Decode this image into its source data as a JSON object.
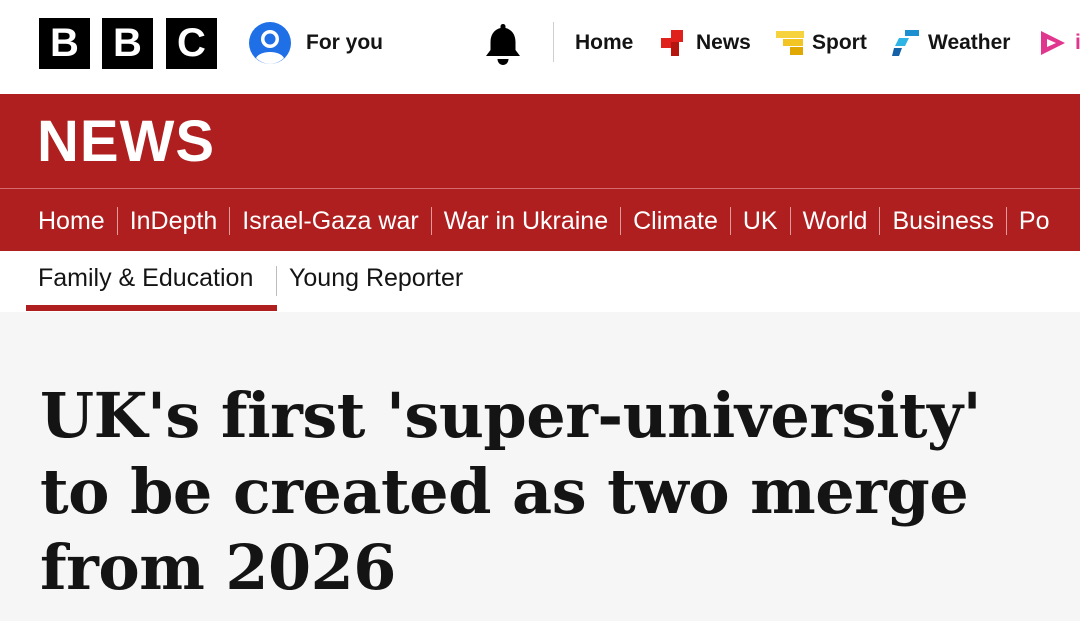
{
  "header": {
    "logo_letters": [
      "B",
      "B",
      "C"
    ],
    "for_you_label": "For you",
    "nav": [
      {
        "label": "Home",
        "icon": "none"
      },
      {
        "label": "News",
        "icon": "news-icon"
      },
      {
        "label": "Sport",
        "icon": "sport-icon"
      },
      {
        "label": "Weather",
        "icon": "weather-icon"
      },
      {
        "label": "i",
        "icon": "iplayer-icon"
      }
    ]
  },
  "section": {
    "wordmark": "NEWS",
    "nav": [
      "Home",
      "InDepth",
      "Israel-Gaza war",
      "War in Ukraine",
      "Climate",
      "UK",
      "World",
      "Business",
      "Po"
    ]
  },
  "subnav": {
    "items": [
      "Family & Education",
      "Young Reporter"
    ],
    "active": "Family & Education"
  },
  "article": {
    "headline": "UK's first 'super-university' to be created as two merge from 2026"
  },
  "colors": {
    "brand_red": "#b01f1f",
    "news_icon_red": "#e0201a",
    "sport_yellow": "#f2c522",
    "weather_blue": "#1c8fd0",
    "iplayer_pink": "#e0368e",
    "account_blue": "#1f6fe6"
  }
}
